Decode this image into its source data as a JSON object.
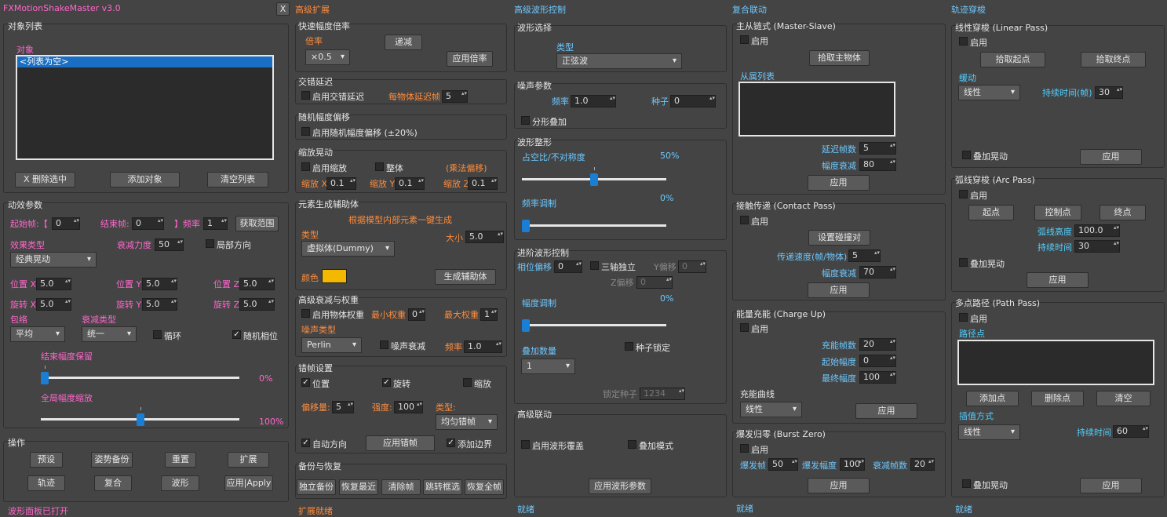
{
  "left": {
    "title": "FXMotionShakeMaster v3.0",
    "close": "X",
    "objlist_group": "对象列表",
    "obj_label": "对象",
    "obj_item": "<列表为空>",
    "btn_delete": "X 删除选中",
    "btn_add": "添加对象",
    "btn_clear": "清空列表",
    "params_group": "动效参数",
    "start_label": "起始帧:【",
    "start_val": "0",
    "end_label": "结束帧:",
    "end_val": "0",
    "freq_label": "】频率",
    "freq_val": "1",
    "btn_range": "获取范围",
    "effect_type_label": "效果类型",
    "effect_type_val": "经典晃动",
    "decay_label": "衰减力度",
    "decay_val": "50",
    "local_label": "局部方向",
    "pos_x_label": "位置 X",
    "pos_x_val": "5.0",
    "pos_y_label": "位置 Y",
    "pos_y_val": "5.0",
    "pos_z_label": "位置 Z",
    "pos_z_val": "5.0",
    "rot_x_label": "旋转 X",
    "rot_x_val": "5.0",
    "rot_y_label": "旋转 Y",
    "rot_y_val": "5.0",
    "rot_z_label": "旋转 Z",
    "rot_z_val": "5.0",
    "wrap_label": "包络",
    "wrap_val": "平均",
    "decay_type_label": "衰减类型",
    "decay_type_val": "统一",
    "loop_label": "循环",
    "random_phase_label": "随机相位",
    "end_keep_label": "结束幅度保留",
    "end_keep_val": "0%",
    "end_keep_level": 0,
    "global_scale_label": "全局幅度缩放",
    "global_scale_val": "100%",
    "global_scale_level": 0.5,
    "ops_group": "操作",
    "btn_preset": "预设",
    "btn_pose_backup": "姿势备份",
    "btn_reset": "重置",
    "btn_expand": "扩展",
    "btn_track": "轨迹",
    "btn_composite": "复合",
    "btn_wave": "波形",
    "btn_apply": "应用|Apply",
    "status": "波形面板已打开"
  },
  "adv": {
    "title": "高级扩展",
    "quick_group": "快速幅度倍率",
    "mult_label": "倍率",
    "mult_val": "×0.5",
    "btn_decr": "递减",
    "btn_apply_mult": "应用倍率",
    "stagger_group": "交错延迟",
    "stagger_enable": "启用交错延迟",
    "per_obj_label": "每物体延迟帧",
    "per_obj_val": "5",
    "rand_group": "随机幅度偏移",
    "rand_enable": "启用随机幅度偏移 (±20%)",
    "scale_group": "缩放晃动",
    "scale_enable": "启用缩放",
    "whole_label": "整体",
    "mult_offset_label": "(乘法偏移)",
    "sx_label": "缩放 X",
    "sx_val": "0.1",
    "sy_label": "缩放 Y",
    "sy_val": "0.1",
    "sz_label": "缩放 Z",
    "sz_val": "0.1",
    "gen_group": "元素生成辅助体",
    "gen_desc": "根据模型内部元素一键生成",
    "type_label": "类型",
    "size_label": "大小",
    "size_val": "5.0",
    "type_val": "虚拟体(Dummy)",
    "color_label": "颜色",
    "color_swatch": "#f5b800",
    "btn_gen": "生成辅助体",
    "adv_decay_group": "高级衰减与权重",
    "weight_enable": "启用物体权重",
    "min_weight_label": "最小权重",
    "min_weight_val": "0",
    "max_weight_label": "最大权重",
    "max_weight_val": "1",
    "noise_type_label": "噪声类型",
    "noise_type_val": "Perlin",
    "noise_decay_label": "噪声衰减",
    "noise_freq_label": "频率",
    "noise_freq_val": "1.0",
    "offset_group": "错帧设置",
    "pos_label": "位置",
    "rot_label": "旋转",
    "scl_label": "缩放",
    "offset_amt_label": "偏移量:",
    "offset_amt_val": "5",
    "strength_label": "强度:",
    "strength_val": "100",
    "otype_label": "类型:",
    "otype_val": "均匀错帧",
    "auto_dir_label": "自动方向",
    "btn_apply_offset": "应用错帧",
    "add_border_label": "添加边界",
    "backup_group": "备份与恢复",
    "btn_ind_backup": "独立备份",
    "btn_restore_recent": "恢复最近",
    "btn_clear_frames": "清除帧",
    "btn_jump_select": "跳转框选",
    "btn_restore_all": "恢复全帧",
    "footer": "扩展就绪"
  },
  "wave": {
    "title": "高级波形控制",
    "sel_group": "波形选择",
    "type_label": "类型",
    "type_val": "正弦波",
    "noise_group": "噪声参数",
    "freq_label": "频率",
    "freq_val": "1.0",
    "seed_label": "种子",
    "seed_val": "0",
    "fractal_label": "分形叠加",
    "shape_group": "波形整形",
    "duty_label": "占空比/不对称度",
    "duty_val": "50%",
    "duty_level": 0.5,
    "fm_label": "频率调制",
    "fm_val": "0%",
    "fm_level": 0,
    "adv_group": "进阶波形控制",
    "phase_label": "相位偏移",
    "phase_val": "0",
    "triaxis_label": "三轴独立",
    "yoff_label": "Y偏移",
    "yoff_val": "0",
    "zoff_label": "Z偏移",
    "zoff_val": "0",
    "amp_mod_label": "幅度调制",
    "amp_mod_val": "0%",
    "amp_mod_level": 0,
    "stack_label": "叠加数量",
    "stack_val": "1",
    "seed_lock_label": "种子锁定",
    "lock_seed_label": "锁定种子",
    "lock_seed_val": "1234",
    "link_group": "高级联动",
    "wave_override_label": "启用波形覆盖",
    "stack_mode_label": "叠加模式",
    "btn_apply_wave": "应用波形参数",
    "footer": "就绪"
  },
  "comp": {
    "title": "复合联动",
    "ms_group": "主从链式 (Master-Slave)",
    "enable1": "启用",
    "btn_pick_master": "拾取主物体",
    "slave_list_label": "从属列表",
    "delay_label": "延迟帧数",
    "delay_val": "5",
    "amp_decay_label": "幅度衰减",
    "amp_decay_val": "80",
    "btn_apply1": "应用",
    "cp_group": "接触传递 (Contact Pass)",
    "enable2": "启用",
    "btn_set_collision": "设置碰撞对",
    "pass_speed_label": "传递速度(帧/物体)",
    "pass_speed_val": "5",
    "amp_decay2_label": "幅度衰减",
    "amp_decay2_val": "70",
    "btn_apply2": "应用",
    "cu_group": "能量充能 (Charge Up)",
    "enable3": "启用",
    "charge_frames_label": "充能帧数",
    "charge_frames_val": "20",
    "start_amp_label": "起始幅度",
    "start_amp_val": "0",
    "final_amp_label": "最终幅度",
    "final_amp_val": "100",
    "curve_label": "充能曲线",
    "curve_val": "线性",
    "btn_apply3": "应用",
    "bz_group": "爆发归零 (Burst Zero)",
    "enable4": "启用",
    "burst_frame_label": "爆发帧",
    "burst_frame_val": "50",
    "burst_amp_label": "爆发幅度",
    "burst_amp_val": "100",
    "decay_frames_label": "衰减帧数",
    "decay_frames_val": "20",
    "btn_apply4": "应用",
    "footer": "就绪"
  },
  "track": {
    "title": "轨迹穿梭",
    "lp_group": "线性穿梭 (Linear Pass)",
    "enable1": "启用",
    "btn_pick_start": "拾取起点",
    "btn_pick_end": "拾取终点",
    "ease_label": "缓动",
    "ease_val": "线性",
    "dur_label": "持续时间(帧)",
    "dur_val": "30",
    "stack1_label": "叠加晃动",
    "btn_apply1": "应用",
    "ap_group": "弧线穿梭 (Arc Pass)",
    "enable2": "启用",
    "btn_start": "起点",
    "btn_ctrl": "控制点",
    "btn_end": "终点",
    "arc_h_label": "弧线高度",
    "arc_h_val": "100.0",
    "dur2_label": "持续时间",
    "dur2_val": "30",
    "stack2_label": "叠加晃动",
    "btn_apply2": "应用",
    "pp_group": "多点路径 (Path Pass)",
    "enable3": "启用",
    "path_points_label": "路径点",
    "btn_add_pt": "添加点",
    "btn_del_pt": "删除点",
    "btn_clear_pt": "清空",
    "interp_label": "插值方式",
    "interp_val": "线性",
    "dur3_label": "持续时间",
    "dur3_val": "60",
    "stack3_label": "叠加晃动",
    "btn_apply3": "应用",
    "footer": "就绪"
  }
}
